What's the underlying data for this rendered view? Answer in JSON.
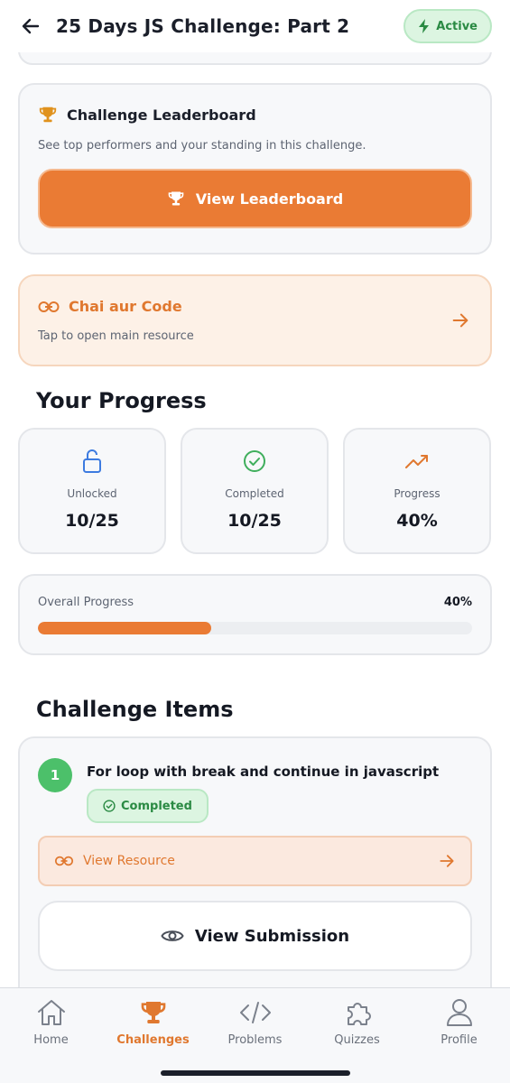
{
  "header": {
    "title": "25 Days JS Challenge: Part 2",
    "status": "Active",
    "back_icon": "arrow-left-icon",
    "status_icon": "bolt-icon"
  },
  "leaderboard": {
    "title": "Challenge Leaderboard",
    "description": "See top performers and your standing in this challenge.",
    "button_label": "View Leaderboard",
    "icon": "trophy-icon"
  },
  "resource": {
    "title": "Chai aur Code",
    "subtitle": "Tap to open main resource",
    "icon": "link-icon",
    "arrow_icon": "arrow-right-icon"
  },
  "progress": {
    "heading": "Your Progress",
    "stats": [
      {
        "label": "Unlocked",
        "value": "10/25",
        "icon": "unlock-icon"
      },
      {
        "label": "Completed",
        "value": "10/25",
        "icon": "check-circle-icon"
      },
      {
        "label": "Progress",
        "value": "40%",
        "icon": "trending-up-icon"
      }
    ],
    "overall_label": "Overall Progress",
    "overall_value": "40%",
    "overall_fraction": 0.4
  },
  "items": {
    "heading": "Challenge Items",
    "list": [
      {
        "number": "1",
        "title": "For loop with break and continue in javascript",
        "badge": "Completed",
        "resource_label": "View Resource",
        "submission_label": "View Submission"
      }
    ]
  },
  "nav": {
    "items": [
      {
        "label": "Home",
        "icon": "home-icon",
        "active": false
      },
      {
        "label": "Challenges",
        "icon": "trophy-icon",
        "active": true
      },
      {
        "label": "Problems",
        "icon": "code-icon",
        "active": false
      },
      {
        "label": "Quizzes",
        "icon": "puzzle-icon",
        "active": false
      },
      {
        "label": "Profile",
        "icon": "user-icon",
        "active": false
      }
    ]
  },
  "colors": {
    "accent": "#ea7b34",
    "success": "#4cc06a",
    "success_bg": "#dcf5e1"
  }
}
